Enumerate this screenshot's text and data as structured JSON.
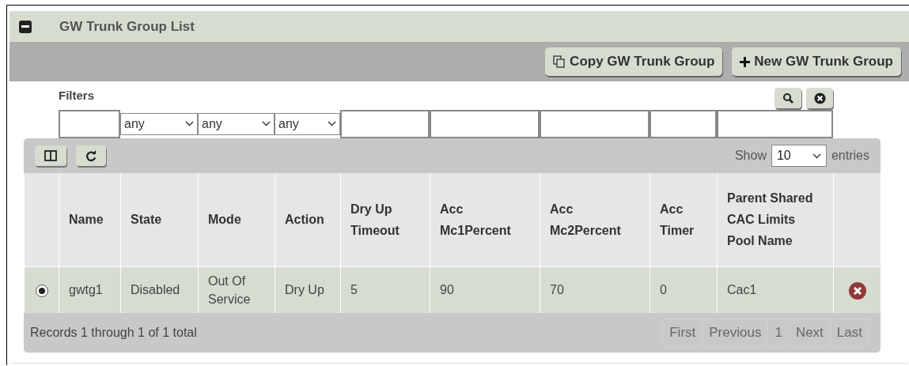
{
  "panel": {
    "title": "GW Trunk Group List",
    "expanded": true
  },
  "actions": [
    {
      "kind": "copy",
      "label": "Copy GW Trunk Group"
    },
    {
      "kind": "new",
      "label": "New GW Trunk Group"
    }
  ],
  "filters": {
    "label": "Filters",
    "fields": [
      {
        "kind": "text"
      },
      {
        "kind": "select",
        "value": "any"
      },
      {
        "kind": "select",
        "value": "any"
      },
      {
        "kind": "select",
        "value": "any"
      },
      {
        "kind": "text"
      },
      {
        "kind": "text"
      },
      {
        "kind": "text"
      },
      {
        "kind": "text"
      },
      {
        "kind": "text"
      }
    ]
  },
  "length": {
    "before": "Show",
    "value": "10",
    "after": "entries"
  },
  "table": {
    "columns": [
      "",
      "Name",
      "State",
      "Mode",
      "Action",
      "Dry Up Timeout",
      "Acc Mc1Percent",
      "Acc Mc2Percent",
      "Acc Timer",
      "Parent Shared CAC Limits Pool Name",
      ""
    ],
    "rows": [
      {
        "selected": true,
        "cells": [
          "",
          "gwtg1",
          "Disabled",
          "Out Of Service",
          "Dry Up",
          "5",
          "90",
          "70",
          "0",
          "Cac1"
        ]
      }
    ]
  },
  "footer": {
    "info": "Records 1 through 1 of 1 total",
    "pages": [
      {
        "label": "First",
        "disabled": true
      },
      {
        "label": "Previous",
        "disabled": true
      },
      {
        "label": "1",
        "disabled": true
      },
      {
        "label": "Next",
        "disabled": true
      },
      {
        "label": "Last",
        "disabled": true
      }
    ]
  }
}
